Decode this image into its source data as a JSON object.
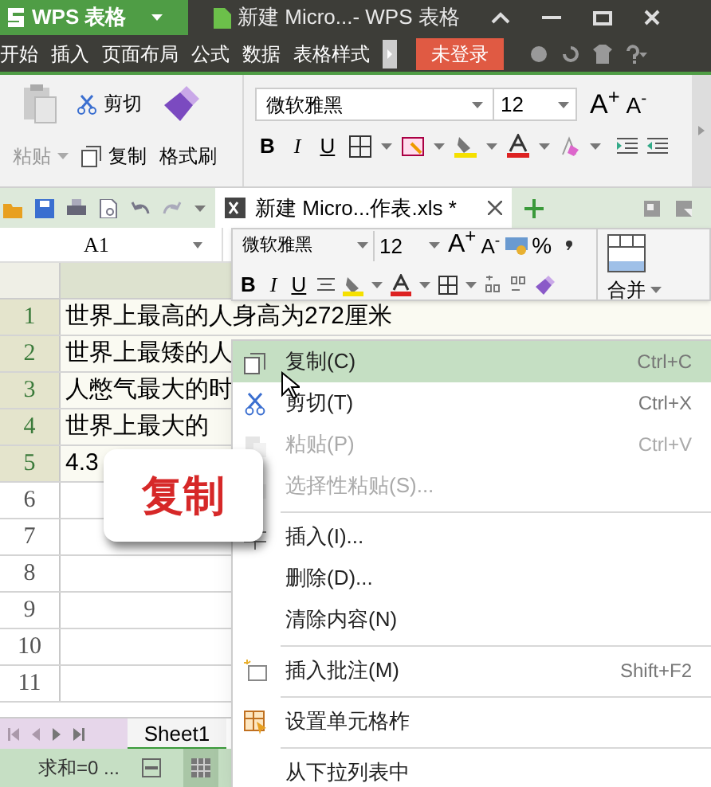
{
  "title_bar": {
    "app_button": "WPS 表格",
    "document_title": "新建 Micro...- WPS 表格"
  },
  "menu_bar": {
    "items": [
      "开始",
      "插入",
      "页面布局",
      "公式",
      "数据",
      "表格样式"
    ],
    "login_button": "未登录"
  },
  "ribbon": {
    "paste": "粘贴",
    "cut": "剪切",
    "copy": "复制",
    "format_painter": "格式刷",
    "font": "微软雅黑",
    "size": "12",
    "grow": "A$^{+}$",
    "shrink": "A$^{-}$",
    "styles": [
      "B",
      "I",
      "U"
    ]
  },
  "document_tab": {
    "label": "新建 Micro...作表.xls *"
  },
  "name_box": "A1",
  "mini_toolbar": {
    "font": "微软雅黑",
    "size": "12",
    "grow": "A$^{+}$",
    "shrink": "A$^{-}$",
    "percent": "%",
    "styles": [
      "B",
      "I",
      "U"
    ],
    "merge": "合并"
  },
  "rows": [
    {
      "number": "1",
      "text": "世界上最高的人身高为272厘米",
      "selected": true
    },
    {
      "number": "2",
      "text": "世界上最矮的人",
      "selected": true
    },
    {
      "number": "3",
      "text": "人憋气最大的时",
      "selected": true
    },
    {
      "number": "4",
      "text": "世界上最大的",
      "selected": true
    },
    {
      "number": "5",
      "text": "4.3",
      "selected": true
    },
    {
      "number": "6",
      "text": "",
      "selected": false
    },
    {
      "number": "7",
      "text": "",
      "selected": false
    },
    {
      "number": "8",
      "text": "",
      "selected": false
    },
    {
      "number": "9",
      "text": "",
      "selected": false
    },
    {
      "number": "10",
      "text": "",
      "selected": false
    },
    {
      "number": "11",
      "text": "",
      "selected": false
    }
  ],
  "callout": "复制",
  "context_menu": [
    {
      "label": "复制(C)",
      "shortcut": "Ctrl+C",
      "selected": true,
      "disabled": false,
      "separator_before": false
    },
    {
      "label": "剪切(T)",
      "shortcut": "Ctrl+X",
      "selected": false,
      "disabled": false,
      "separator_before": false
    },
    {
      "label": "粘贴(P)",
      "shortcut": "Ctrl+V",
      "selected": false,
      "disabled": true,
      "separator_before": false
    },
    {
      "label": "选择性粘贴(S)...",
      "selected": false,
      "disabled": true,
      "separator_before": false
    },
    {
      "label": "插入(I)...",
      "selected": false,
      "disabled": false,
      "separator_before": true
    },
    {
      "label": "删除(D)...",
      "selected": false,
      "disabled": false,
      "separator_before": false
    },
    {
      "label": "清除内容(N)",
      "selected": false,
      "disabled": false,
      "separator_before": false
    },
    {
      "label": "插入批注(M)",
      "shortcut": "Shift+F2",
      "selected": false,
      "disabled": false,
      "separator_before": true
    },
    {
      "label": "设置单元格柞",
      "selected": false,
      "disabled": false,
      "separator_before": true
    },
    {
      "label": "从下拉列表中",
      "selected": false,
      "disabled": false,
      "separator_before": true
    }
  ],
  "sheet_tab": {
    "label": "Sheet1",
    "selected": true
  },
  "status_bar": {
    "text": "求和=0 ..."
  }
}
